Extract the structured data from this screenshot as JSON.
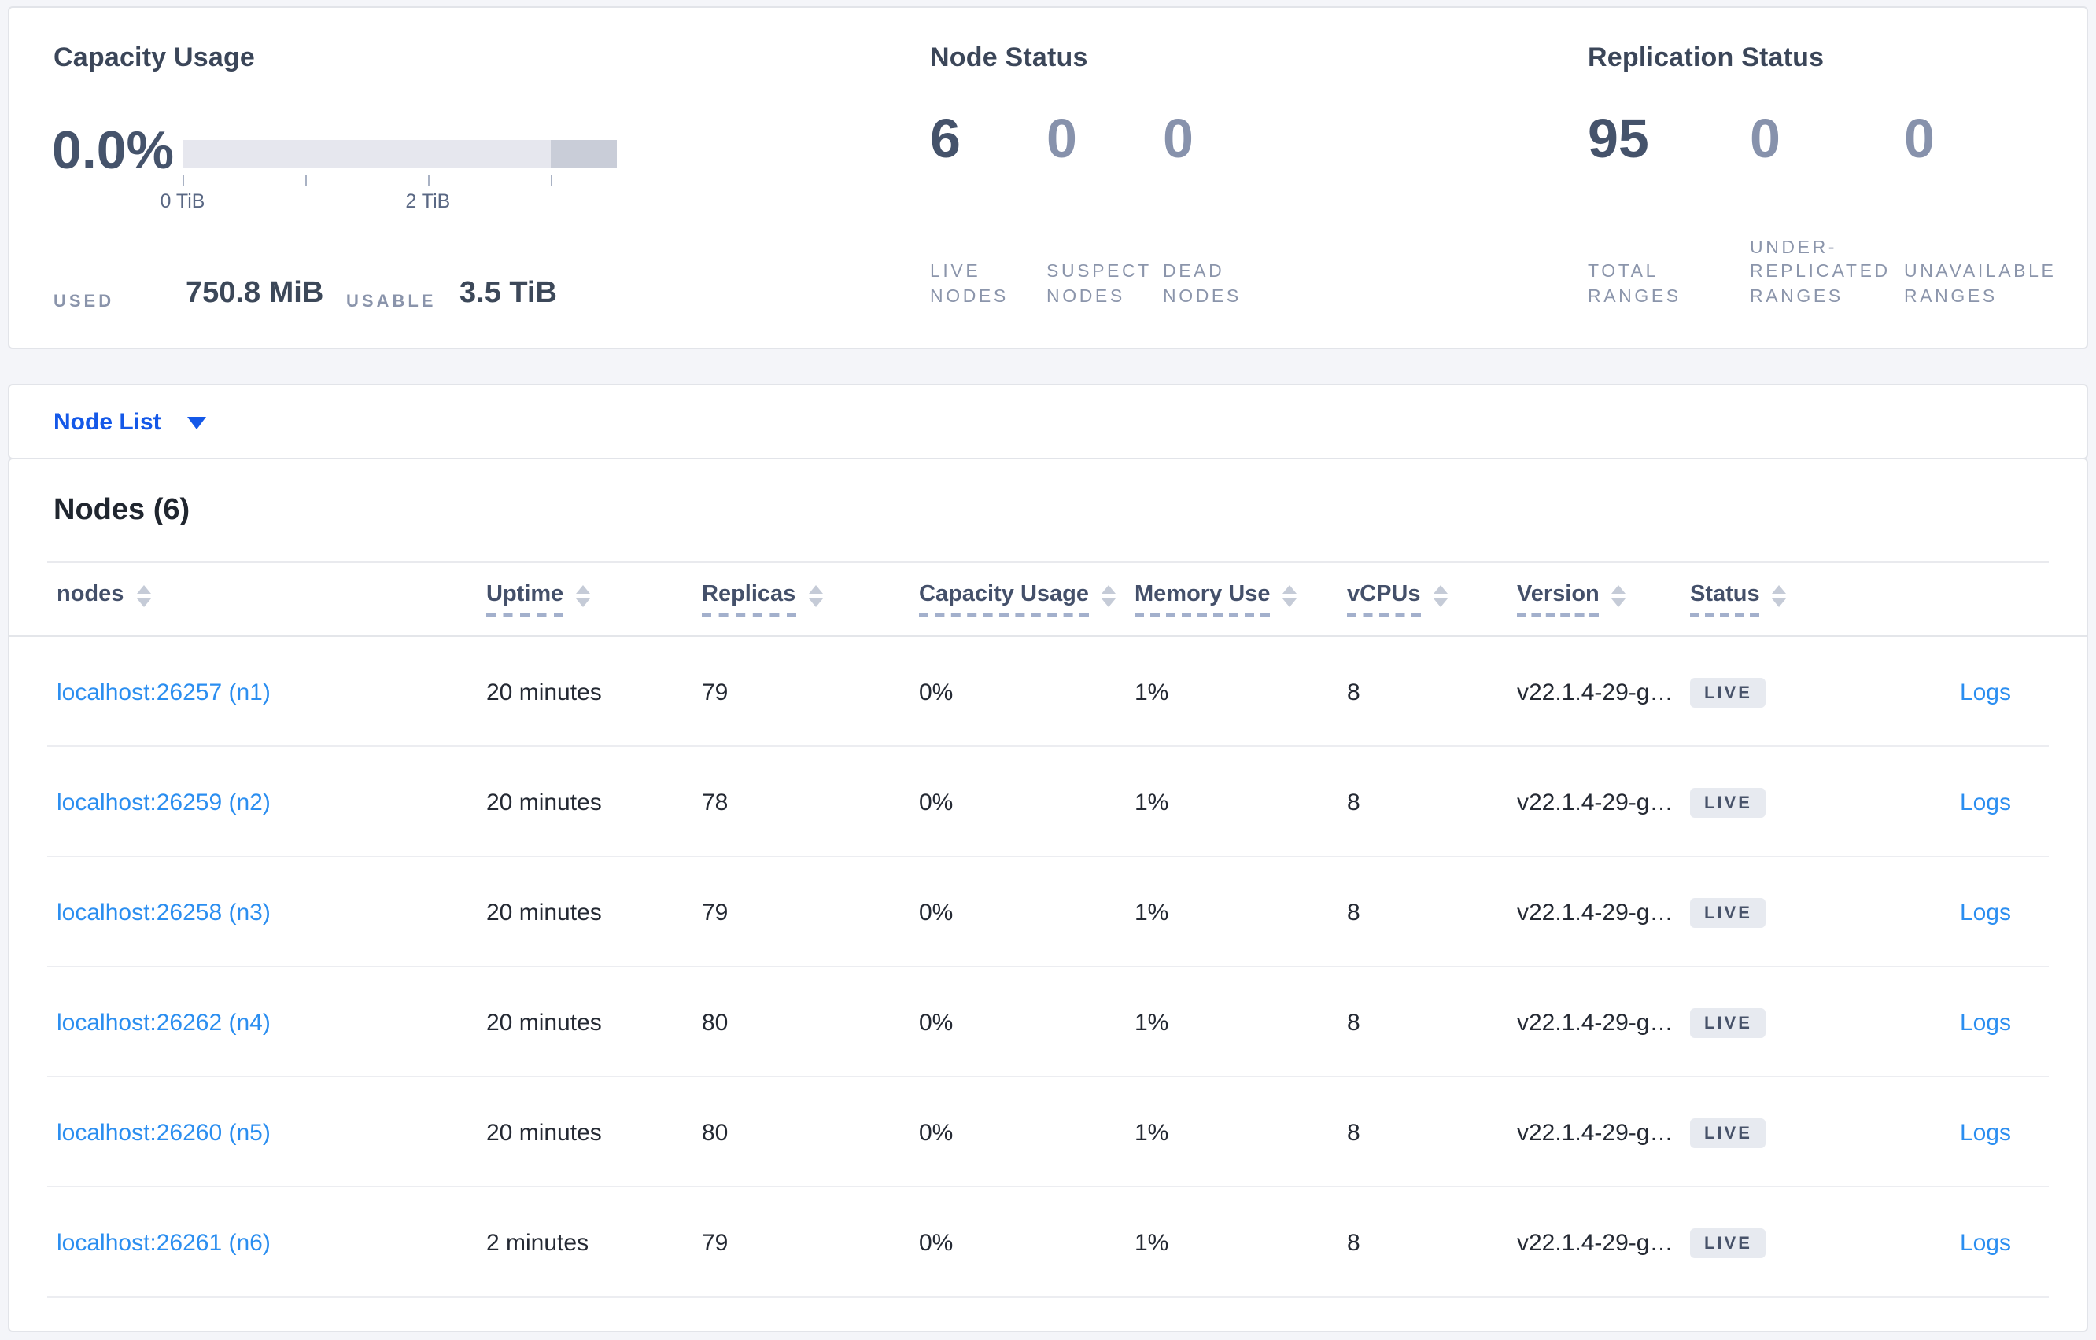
{
  "colors": {
    "page_background": "#f4f5f9",
    "card_border": "#e2e4e9",
    "accent_blue_dropdown": "#1458e8",
    "accent_blue_link": "#2b8ef0",
    "bar_light": "#e6e7ee",
    "bar_dark": "#c9cdd8",
    "badge_background": "#e7eaf0",
    "badge_text": "#475269"
  },
  "summary": {
    "capacity": {
      "title": "Capacity Usage",
      "percent": "0.0%",
      "used_label": "USED",
      "used_value": "750.8 MiB",
      "usable_label": "USABLE",
      "usable_value": "3.5 TiB",
      "bar": {
        "total_tib": 3.54,
        "dark_segment_start_tib": 3.0,
        "ticks_tib": [
          0,
          1,
          2,
          3
        ],
        "tick_labels": [
          {
            "tib": 0,
            "label": "0 TiB"
          },
          {
            "tib": 2,
            "label": "2 TiB"
          }
        ]
      }
    },
    "node_status": {
      "title": "Node Status",
      "stats": [
        {
          "value": "6",
          "emphasis": true,
          "label_lines": [
            "LIVE",
            "NODES"
          ]
        },
        {
          "value": "0",
          "emphasis": false,
          "label_lines": [
            "SUSPECT",
            "NODES"
          ]
        },
        {
          "value": "0",
          "emphasis": false,
          "label_lines": [
            "DEAD",
            "NODES"
          ]
        }
      ]
    },
    "replication": {
      "title": "Replication Status",
      "stats": [
        {
          "value": "95",
          "emphasis": true,
          "label_lines": [
            "TOTAL",
            "RANGES"
          ]
        },
        {
          "value": "0",
          "emphasis": false,
          "label_lines": [
            "UNDER-",
            "REPLICATED",
            "RANGES"
          ]
        },
        {
          "value": "0",
          "emphasis": false,
          "label_lines": [
            "UNAVAILABLE",
            "RANGES"
          ]
        }
      ]
    }
  },
  "node_list_bar": {
    "label": "Node List"
  },
  "table": {
    "heading": "Nodes (6)",
    "columns": [
      {
        "label": "nodes",
        "underlined": false
      },
      {
        "label": "Uptime",
        "underlined": true
      },
      {
        "label": "Replicas",
        "underlined": true
      },
      {
        "label": "Capacity Usage",
        "underlined": true
      },
      {
        "label": "Memory Use",
        "underlined": true
      },
      {
        "label": "vCPUs",
        "underlined": true
      },
      {
        "label": "Version",
        "underlined": true
      },
      {
        "label": "Status",
        "underlined": true
      }
    ],
    "rows": [
      {
        "node": "localhost:26257 (n1)",
        "uptime": "20 minutes",
        "replicas": "79",
        "capacity_usage": "0%",
        "memory_use": "1%",
        "vcpus": "8",
        "version": "v22.1.4-29-g…",
        "status": "LIVE",
        "logs": "Logs"
      },
      {
        "node": "localhost:26259 (n2)",
        "uptime": "20 minutes",
        "replicas": "78",
        "capacity_usage": "0%",
        "memory_use": "1%",
        "vcpus": "8",
        "version": "v22.1.4-29-g…",
        "status": "LIVE",
        "logs": "Logs"
      },
      {
        "node": "localhost:26258 (n3)",
        "uptime": "20 minutes",
        "replicas": "79",
        "capacity_usage": "0%",
        "memory_use": "1%",
        "vcpus": "8",
        "version": "v22.1.4-29-g…",
        "status": "LIVE",
        "logs": "Logs"
      },
      {
        "node": "localhost:26262 (n4)",
        "uptime": "20 minutes",
        "replicas": "80",
        "capacity_usage": "0%",
        "memory_use": "1%",
        "vcpus": "8",
        "version": "v22.1.4-29-g…",
        "status": "LIVE",
        "logs": "Logs"
      },
      {
        "node": "localhost:26260 (n5)",
        "uptime": "20 minutes",
        "replicas": "80",
        "capacity_usage": "0%",
        "memory_use": "1%",
        "vcpus": "8",
        "version": "v22.1.4-29-g…",
        "status": "LIVE",
        "logs": "Logs"
      },
      {
        "node": "localhost:26261 (n6)",
        "uptime": "2 minutes",
        "replicas": "79",
        "capacity_usage": "0%",
        "memory_use": "1%",
        "vcpus": "8",
        "version": "v22.1.4-29-g…",
        "status": "LIVE",
        "logs": "Logs"
      }
    ]
  }
}
